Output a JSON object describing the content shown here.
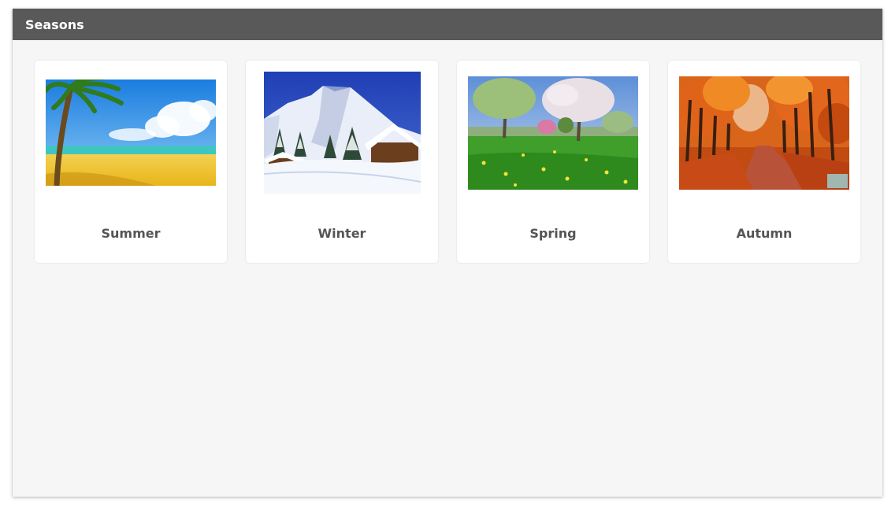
{
  "window": {
    "title": "Seasons"
  },
  "cards": [
    {
      "label": "Summer",
      "image": "beach-palm-image"
    },
    {
      "label": "Winter",
      "image": "snowy-mountain-cabin-image"
    },
    {
      "label": "Spring",
      "image": "blossom-meadow-image"
    },
    {
      "label": "Autumn",
      "image": "autumn-tree-avenue-image"
    }
  ]
}
